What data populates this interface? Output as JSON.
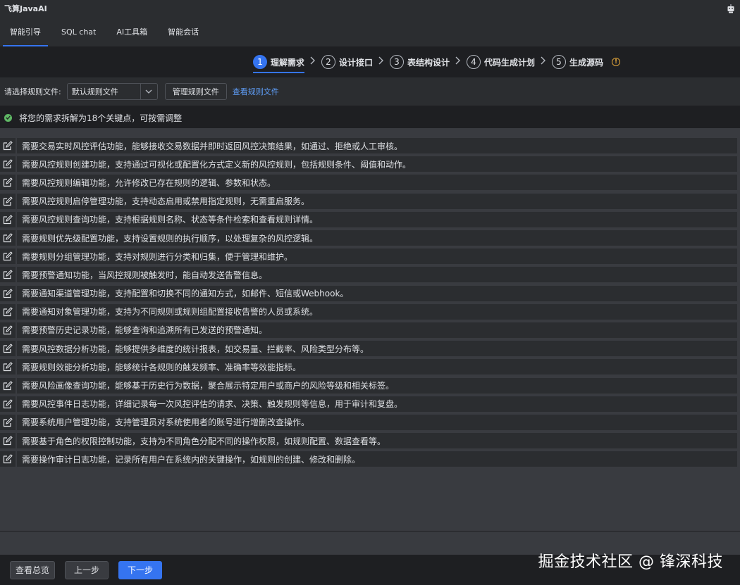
{
  "app": {
    "title": "飞算JavaAI",
    "robot_icon": "robot-icon"
  },
  "tabs": [
    {
      "label": "智能引导",
      "active": true
    },
    {
      "label": "SQL chat",
      "active": false
    },
    {
      "label": "AI工具箱",
      "active": false
    },
    {
      "label": "智能会话",
      "active": false
    }
  ],
  "steps": [
    {
      "num": "1",
      "label": "理解需求",
      "active": true
    },
    {
      "num": "2",
      "label": "设计接口",
      "active": false
    },
    {
      "num": "3",
      "label": "表结构设计",
      "active": false
    },
    {
      "num": "4",
      "label": "代码生成计划",
      "active": false
    },
    {
      "num": "5",
      "label": "生成源码",
      "active": false
    }
  ],
  "info_icon_glyph": "!",
  "rule": {
    "label": "请选择规则文件:",
    "selected": "默认规则文件",
    "manage_button": "管理规则文件",
    "view_link": "查看规则文件"
  },
  "summary": {
    "text": "将您的需求拆解为18个关键点，可按需调整"
  },
  "requirements": [
    "需要交易实时风控评估功能，能够接收交易数据并即时返回风控决策结果，如通过、拒绝或人工审核。",
    "需要风控规则创建功能，支持通过可视化或配置化方式定义新的风控规则，包括规则条件、阈值和动作。",
    "需要风控规则编辑功能，允许修改已存在规则的逻辑、参数和状态。",
    "需要风控规则启停管理功能，支持动态启用或禁用指定规则，无需重启服务。",
    "需要风控规则查询功能，支持根据规则名称、状态等条件检索和查看规则详情。",
    "需要规则优先级配置功能，支持设置规则的执行顺序，以处理复杂的风控逻辑。",
    "需要规则分组管理功能，支持对规则进行分类和归集，便于管理和维护。",
    "需要预警通知功能，当风控规则被触发时，能自动发送告警信息。",
    "需要通知渠道管理功能，支持配置和切换不同的通知方式，如邮件、短信或Webhook。",
    "需要通知对象管理功能，支持为不同规则或规则组配置接收告警的人员或系统。",
    "需要预警历史记录功能，能够查询和追溯所有已发送的预警通知。",
    "需要风控数据分析功能，能够提供多维度的统计报表，如交易量、拦截率、风险类型分布等。",
    "需要规则效能分析功能，能够统计各规则的触发频率、准确率等效能指标。",
    "需要风险画像查询功能，能够基于历史行为数据，聚合展示特定用户或商户的风险等级和相关标签。",
    "需要风控事件日志功能，详细记录每一次风控评估的请求、决策、触发规则等信息，用于审计和复盘。",
    "需要系统用户管理功能，支持管理员对系统使用者的账号进行增删改查操作。",
    "需要基于角色的权限控制功能，支持为不同角色分配不同的操作权限，如规则配置、数据查看等。",
    "需要操作审计日志功能，记录所有用户在系统内的关键操作，如规则的创建、修改和删除。"
  ],
  "footer": {
    "overview_button": "查看总览",
    "prev_button": "上一步",
    "next_button": "下一步"
  },
  "watermark": "掘金技术社区 @ 锋深科技",
  "colors": {
    "accent": "#3574f0",
    "success": "#5fb865",
    "warning": "#e0a43a",
    "link": "#5e9cf5"
  }
}
